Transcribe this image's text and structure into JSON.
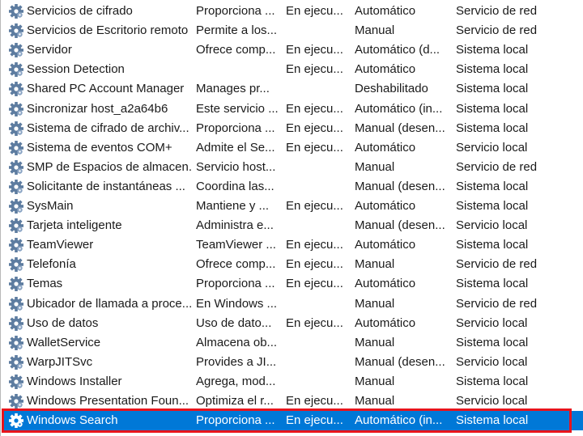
{
  "services": [
    {
      "name": "Servicios de cifrado",
      "description": "Proporciona ...",
      "status": "En ejecu...",
      "startup": "Automático",
      "logon": "Servicio de red",
      "icon": "gear-icon"
    },
    {
      "name": "Servicios de Escritorio remoto",
      "description": "Permite a los...",
      "status": "",
      "startup": "Manual",
      "logon": "Servicio de red",
      "icon": "gear-icon"
    },
    {
      "name": "Servidor",
      "description": "Ofrece comp...",
      "status": "En ejecu...",
      "startup": "Automático (d...",
      "logon": "Sistema local",
      "icon": "gear-icon"
    },
    {
      "name": "Session Detection",
      "description": "",
      "status": "En ejecu...",
      "startup": "Automático",
      "logon": "Sistema local",
      "icon": "gear-icon"
    },
    {
      "name": "Shared PC Account Manager",
      "description": "Manages pr...",
      "status": "",
      "startup": "Deshabilitado",
      "logon": "Sistema local",
      "icon": "gear-icon"
    },
    {
      "name": "Sincronizar host_a2a64b6",
      "description": "Este servicio ...",
      "status": "En ejecu...",
      "startup": "Automático (in...",
      "logon": "Sistema local",
      "icon": "gear-icon"
    },
    {
      "name": "Sistema de cifrado de archiv...",
      "description": "Proporciona ...",
      "status": "En ejecu...",
      "startup": "Manual (desen...",
      "logon": "Sistema local",
      "icon": "gear-icon"
    },
    {
      "name": "Sistema de eventos COM+",
      "description": "Admite el Se...",
      "status": "En ejecu...",
      "startup": "Automático",
      "logon": "Servicio local",
      "icon": "gear-icon"
    },
    {
      "name": "SMP de Espacios de almacen...",
      "description": "Servicio host...",
      "status": "",
      "startup": "Manual",
      "logon": "Servicio de red",
      "icon": "gear-icon"
    },
    {
      "name": "Solicitante de instantáneas ...",
      "description": "Coordina las...",
      "status": "",
      "startup": "Manual (desen...",
      "logon": "Sistema local",
      "icon": "gear-icon"
    },
    {
      "name": "SysMain",
      "description": "Mantiene y ...",
      "status": "En ejecu...",
      "startup": "Automático",
      "logon": "Sistema local",
      "icon": "gear-icon"
    },
    {
      "name": "Tarjeta inteligente",
      "description": "Administra e...",
      "status": "",
      "startup": "Manual (desen...",
      "logon": "Servicio local",
      "icon": "gear-icon"
    },
    {
      "name": "TeamViewer",
      "description": "TeamViewer ...",
      "status": "En ejecu...",
      "startup": "Automático",
      "logon": "Sistema local",
      "icon": "gear-icon"
    },
    {
      "name": "Telefonía",
      "description": "Ofrece comp...",
      "status": "En ejecu...",
      "startup": "Manual",
      "logon": "Servicio de red",
      "icon": "gear-icon"
    },
    {
      "name": "Temas",
      "description": "Proporciona ...",
      "status": "En ejecu...",
      "startup": "Automático",
      "logon": "Sistema local",
      "icon": "gear-icon"
    },
    {
      "name": "Ubicador de llamada a proce...",
      "description": "En Windows ...",
      "status": "",
      "startup": "Manual",
      "logon": "Servicio de red",
      "icon": "gear-icon"
    },
    {
      "name": "Uso de datos",
      "description": "Uso de dato...",
      "status": "En ejecu...",
      "startup": "Automático",
      "logon": "Servicio local",
      "icon": "gear-icon"
    },
    {
      "name": "WalletService",
      "description": "Almacena ob...",
      "status": "",
      "startup": "Manual",
      "logon": "Sistema local",
      "icon": "gear-icon"
    },
    {
      "name": "WarpJITSvc",
      "description": "Provides a JI...",
      "status": "",
      "startup": "Manual (desen...",
      "logon": "Servicio local",
      "icon": "gear-icon"
    },
    {
      "name": "Windows Installer",
      "description": "Agrega, mod...",
      "status": "",
      "startup": "Manual",
      "logon": "Sistema local",
      "icon": "gear-icon"
    },
    {
      "name": "Windows Presentation Foun...",
      "description": "Optimiza el r...",
      "status": "En ejecu...",
      "startup": "Manual",
      "logon": "Servicio local",
      "icon": "gear-icon"
    },
    {
      "name": "Windows Search",
      "description": "Proporciona ...",
      "status": "En ejecu...",
      "startup": "Automático (in...",
      "logon": "Sistema local",
      "icon": "gear-icon",
      "selected": true
    }
  ],
  "colors": {
    "selection": "#0078d7",
    "highlight_border": "#e8141c",
    "text": "#1a1a1a"
  }
}
